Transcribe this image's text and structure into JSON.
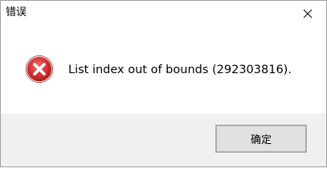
{
  "window": {
    "title": "错误",
    "close_icon": "close-icon"
  },
  "dialog": {
    "icon": "error-icon",
    "message": "List index out of bounds (292303816).",
    "ok_label": "确定"
  },
  "colors": {
    "icon_red": "#d32f2f",
    "footer_bg": "#f0f0f0",
    "button_bg": "#e1e1e1",
    "button_border": "#adadad"
  }
}
